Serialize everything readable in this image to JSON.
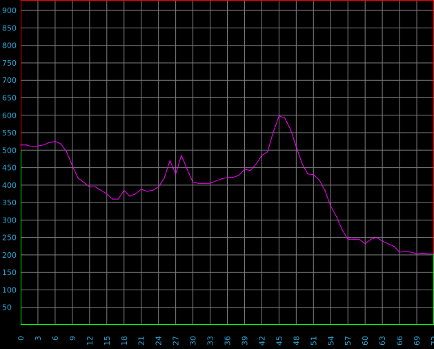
{
  "chart_data": {
    "type": "line",
    "title": "",
    "xlabel": "",
    "ylabel": "",
    "xlim": [
      0,
      72
    ],
    "ylim": [
      0,
      930
    ],
    "grid": true,
    "colors": {
      "background": "#000000",
      "grid": "#808080",
      "line": "#ff00ff",
      "tick_text": "#2aa7d8",
      "border_upper": "#ff0000",
      "border_lower": "#00ff00"
    },
    "x_ticks": [
      "0",
      "3",
      "6",
      "9",
      "12",
      "15",
      "18",
      "21",
      "24",
      "27",
      "30",
      "33",
      "36",
      "39",
      "42",
      "45",
      "48",
      "51",
      "54",
      "57",
      "60",
      "63",
      "66",
      "69",
      "72"
    ],
    "y_ticks": [
      "900",
      "850",
      "800",
      "750",
      "700",
      "650",
      "600",
      "550",
      "500",
      "450",
      "400",
      "350",
      "300",
      "250",
      "200",
      "150",
      "100",
      "50"
    ],
    "series": [
      {
        "name": "",
        "x": [
          0,
          1,
          2,
          3,
          4,
          5,
          6,
          7,
          8,
          9,
          10,
          11,
          12,
          13,
          14,
          15,
          16,
          17,
          18,
          19,
          20,
          21,
          22,
          23,
          24,
          25,
          26,
          27,
          28,
          29,
          30,
          31,
          32,
          33,
          34,
          35,
          36,
          37,
          38,
          39,
          40,
          41,
          42,
          43,
          44,
          45,
          46,
          47,
          48,
          49,
          50,
          51,
          52,
          53,
          54,
          55,
          56,
          57,
          58,
          59,
          60,
          61,
          62,
          63,
          64,
          65,
          66,
          67,
          68,
          69,
          70,
          71,
          72
        ],
        "y": [
          515,
          515,
          510,
          512,
          515,
          522,
          525,
          518,
          495,
          455,
          420,
          408,
          395,
          395,
          385,
          375,
          360,
          360,
          385,
          368,
          375,
          388,
          382,
          385,
          395,
          420,
          470,
          432,
          485,
          445,
          408,
          405,
          405,
          405,
          412,
          418,
          422,
          422,
          428,
          445,
          442,
          460,
          485,
          495,
          552,
          598,
          592,
          560,
          510,
          462,
          432,
          430,
          415,
          385,
          340,
          310,
          272,
          245,
          245,
          245,
          232,
          245,
          250,
          240,
          232,
          225,
          208,
          210,
          208,
          203,
          205,
          203,
          203
        ]
      }
    ]
  }
}
